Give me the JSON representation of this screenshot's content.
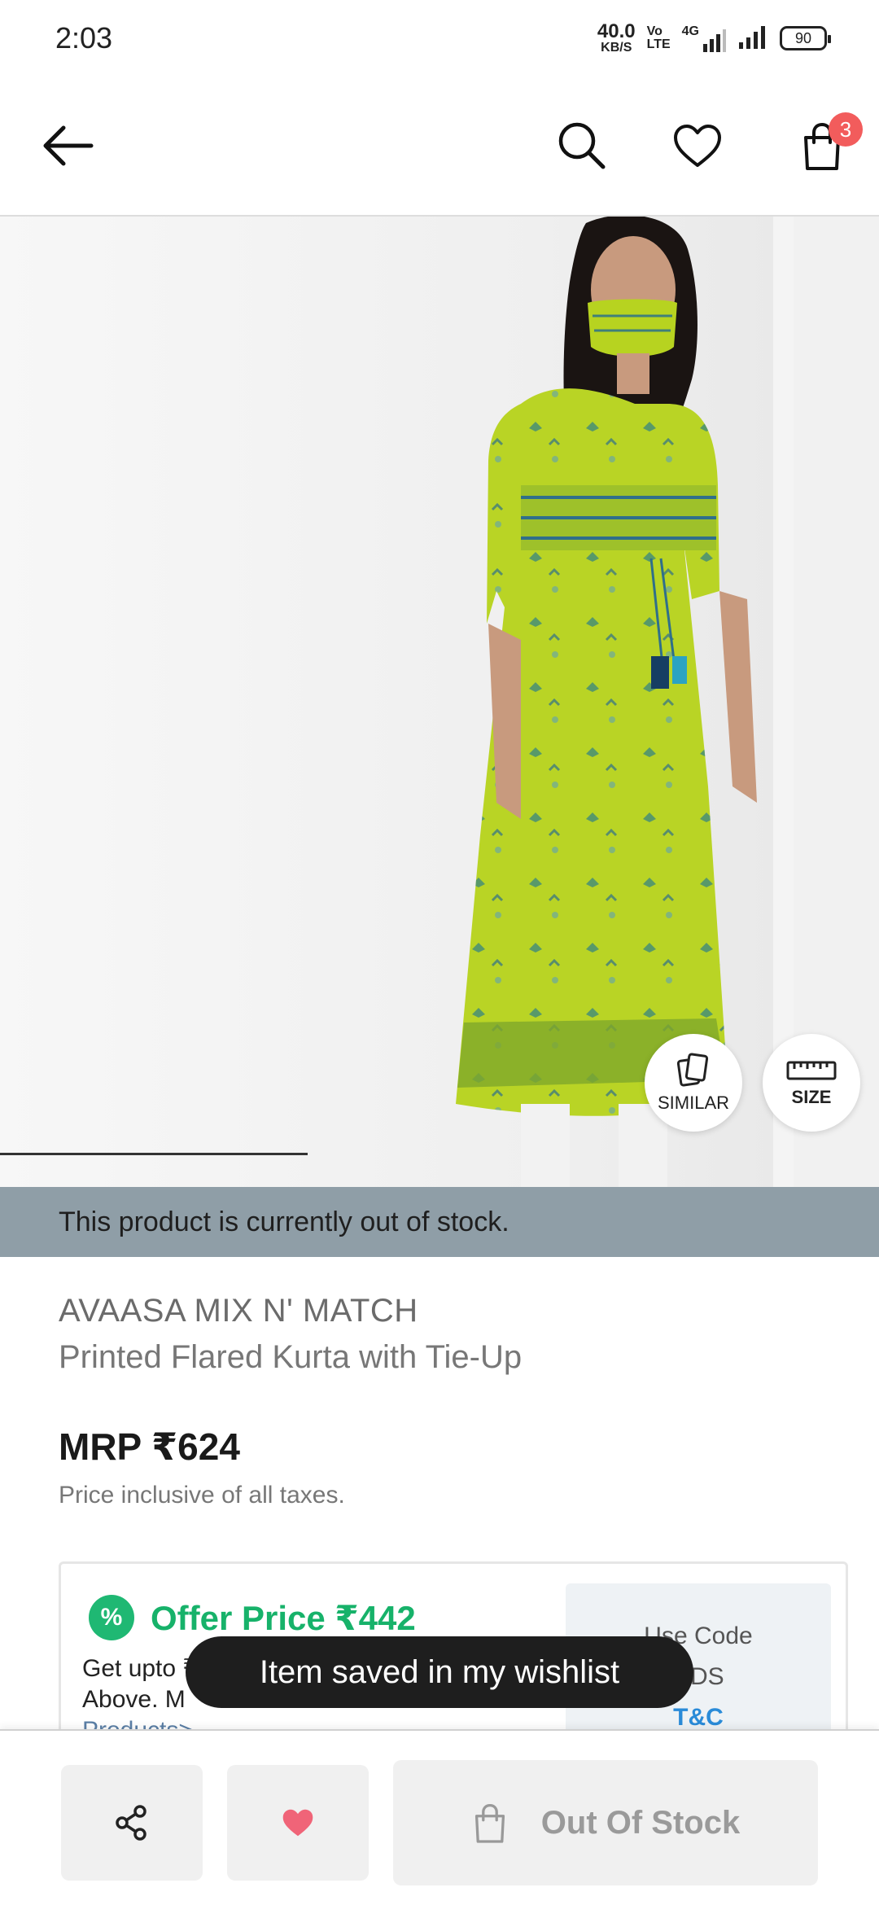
{
  "status_bar": {
    "time": "2:03",
    "net_speed": "40.0",
    "net_unit": "KB/S",
    "volte_top": "Vo",
    "volte_bottom": "LTE",
    "network": "4G",
    "battery": "90"
  },
  "header": {
    "back_icon": "arrow-left-icon",
    "search_icon": "search-icon",
    "wishlist_icon": "heart-outline-icon",
    "cart_icon": "shopping-bag-icon",
    "cart_count": "3"
  },
  "gallery": {
    "image_alt": "model-in-green-printed-kurta",
    "similar_label": "SIMILAR",
    "size_label": "SIZE"
  },
  "stock_banner": "This product is currently out of stock.",
  "product": {
    "brand": "AVAASA MIX N' MATCH",
    "name": "Printed Flared Kurta with Tie-Up",
    "mrp": "MRP ₹624",
    "tax_note": "Price inclusive of all taxes."
  },
  "offer": {
    "badge": "%",
    "title": "Offer Price  ₹442",
    "desc_line1": "Get upto ₹",
    "desc_line2": "Above. M",
    "desc_link": "Products>",
    "code_line1": "Use Code",
    "code_line2": "NDS",
    "code_tc": "T&C"
  },
  "toast": "Item saved in my wishlist",
  "bottom_bar": {
    "share_icon": "share-icon",
    "wishlist_icon": "heart-filled-icon",
    "oos_icon": "shopping-bag-icon",
    "oos_label": "Out Of Stock"
  },
  "colors": {
    "accent_green": "#17b26a",
    "badge_red": "#f25c5c",
    "banner_gray": "#8f9ea7",
    "heart_red": "#f06478"
  }
}
